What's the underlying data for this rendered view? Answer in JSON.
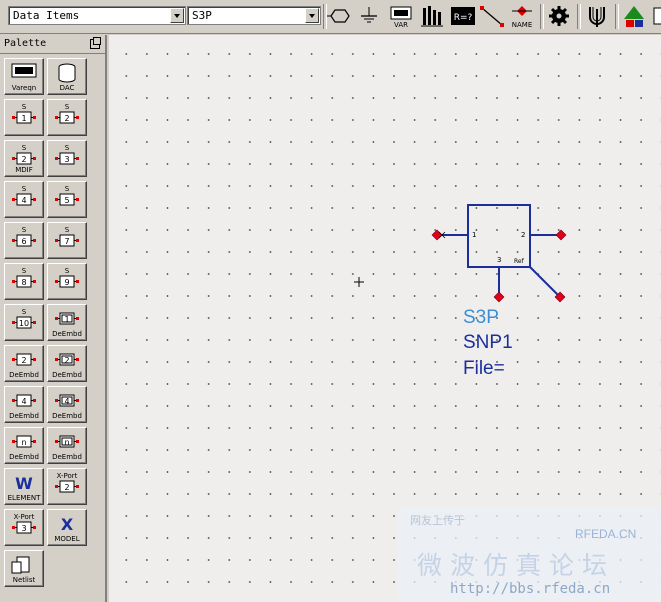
{
  "toolbar": {
    "library_combo": "Data Items",
    "component_combo": "S3P",
    "icons": [
      "port-icon",
      "ground-icon",
      "var-icon",
      "bus-icon",
      "r-equals-icon",
      "wire-icon",
      "name-icon",
      "settings-icon",
      "tuning-icon",
      "push-hierarchy-icon"
    ],
    "var_label": "VAR",
    "req_label": "R=?",
    "name_label": "NAME"
  },
  "palette": {
    "title": "Palette",
    "items": [
      {
        "top": "",
        "bottom": "Vareqn"
      },
      {
        "top": "",
        "bottom": "DAC"
      },
      {
        "top": "S",
        "box": "1",
        "bottom": ""
      },
      {
        "top": "S",
        "box": "2",
        "bottom": ""
      },
      {
        "top": "S",
        "box": "2",
        "bottom": "MDIF"
      },
      {
        "top": "S",
        "box": "3",
        "bottom": ""
      },
      {
        "top": "S",
        "box": "4",
        "bottom": ""
      },
      {
        "top": "S",
        "box": "5",
        "bottom": ""
      },
      {
        "top": "S",
        "box": "6",
        "bottom": ""
      },
      {
        "top": "S",
        "box": "7",
        "bottom": ""
      },
      {
        "top": "S",
        "box": "8",
        "bottom": ""
      },
      {
        "top": "S",
        "box": "9",
        "bottom": ""
      },
      {
        "top": "S",
        "box": "10",
        "bottom": ""
      },
      {
        "top": "",
        "box": "1",
        "bottom": "DeEmbd"
      },
      {
        "top": "",
        "box": "2",
        "bottom": "DeEmbd"
      },
      {
        "top": "",
        "box": "2",
        "bottom": "DeEmbd"
      },
      {
        "top": "",
        "box": "4",
        "bottom": "DeEmbd"
      },
      {
        "top": "",
        "box": "4",
        "bottom": "DeEmbd"
      },
      {
        "top": "",
        "box": "n",
        "bottom": "DeEmbd"
      },
      {
        "top": "",
        "box": "n",
        "bottom": "DeEmbd"
      },
      {
        "top": "W",
        "bottom": "ELEMENT"
      },
      {
        "top": "X-Port",
        "box": "2",
        "bottom": ""
      },
      {
        "top": "X-Port",
        "box": "3",
        "bottom": ""
      },
      {
        "top": "X",
        "bottom": "MODEL"
      },
      {
        "top": "",
        "bottom": "Netlist"
      }
    ]
  },
  "schematic": {
    "component_type": "S3P",
    "instance_name": "SNP1",
    "file_param": "File=",
    "pin1": "1",
    "pin2": "2",
    "pin3": "3",
    "ref_label": "Ref",
    "colors": {
      "type_text": "#3a8fd4",
      "body": "#1b2f9c",
      "pin": "#e0001a"
    }
  },
  "watermark": {
    "top_text": "网友上传于",
    "site": "RFEDA.CN",
    "chinese": "微波仿真论坛",
    "url": "http://bbs.rfeda.cn"
  }
}
